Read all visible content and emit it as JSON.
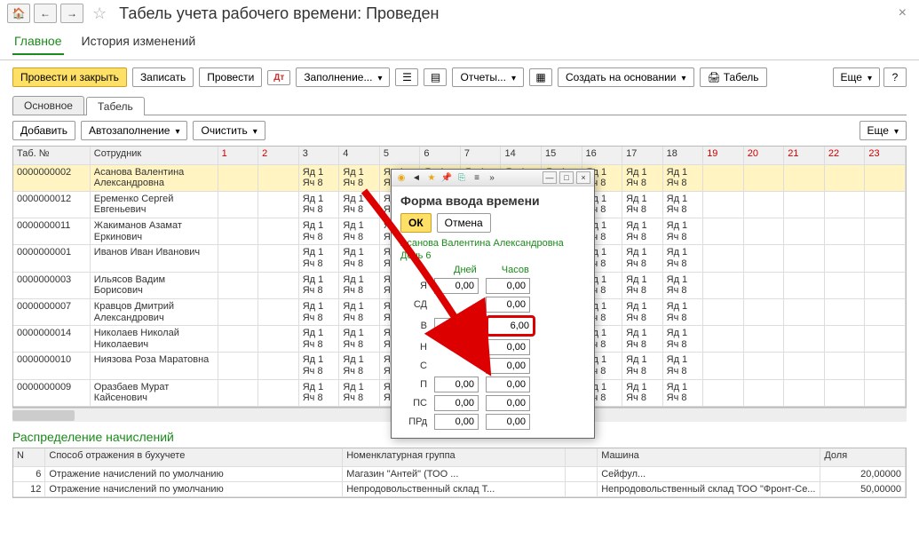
{
  "header": {
    "title": "Табель учета рабочего времени: Проведен"
  },
  "mainTabs": {
    "main": "Главное",
    "history": "История изменений"
  },
  "toolbar": {
    "postClose": "Провести и закрыть",
    "save": "Записать",
    "post": "Провести",
    "fill": "Заполнение...",
    "reports": "Отчеты...",
    "createFrom": "Создать на основании",
    "tabel": "Табель",
    "more": "Еще"
  },
  "subtabs": {
    "main": "Основное",
    "tabel": "Табель"
  },
  "actions": {
    "add": "Добавить",
    "autofill": "Автозаполнение",
    "clear": "Очистить",
    "more": "Еще"
  },
  "tableHead": {
    "num": "Таб. №",
    "emp": "Сотрудник"
  },
  "days": [
    "1",
    "2",
    "3",
    "4",
    "5",
    "6",
    "7",
    "14",
    "15",
    "16",
    "17",
    "18",
    "19",
    "20",
    "21",
    "22",
    "23"
  ],
  "weekendCols": [
    4,
    5,
    16,
    17,
    18,
    19,
    20
  ],
  "cell": {
    "l1": "Яд 1",
    "l2": "Яч 8"
  },
  "rows": [
    {
      "num": "0000000002",
      "emp": "Асанова Валентина Александровна",
      "sel": true
    },
    {
      "num": "0000000012",
      "emp": "Еременко Сергей Евгеньевич"
    },
    {
      "num": "0000000011",
      "emp": "Жакиманов Азамат Еркинович"
    },
    {
      "num": "0000000001",
      "emp": "Иванов Иван Иванович"
    },
    {
      "num": "0000000003",
      "emp": "Ильясов Вадим Борисович"
    },
    {
      "num": "0000000007",
      "emp": "Кравцов Дмитрий Александрович"
    },
    {
      "num": "0000000014",
      "emp": "Николаев Николай Николаевич"
    },
    {
      "num": "0000000010",
      "emp": "Ниязова Роза Маратовна"
    },
    {
      "num": "0000000009",
      "emp": "Оразбаев Мурат Кайсенович"
    }
  ],
  "dist": {
    "title": "Распределение начислений",
    "head": {
      "n": "N",
      "method": "Способ отражения в бухучете",
      "group": "Номенклатурная группа",
      "machine": "Машина",
      "share": "Доля"
    },
    "rows": [
      {
        "n": "6",
        "method": "Отражение начислений по умолчанию",
        "group": "Магазин \"Антей\" (ТОО ...",
        "machine": "Сейфул...",
        "share": "20,00000"
      },
      {
        "n": "12",
        "method": "Отражение начислений по умолчанию",
        "group": "Непродовольственный склад Т...",
        "machine": "Непродовольственный склад ТОО \"Фронт-Се...",
        "share": "50,00000"
      }
    ]
  },
  "modal": {
    "title": "Форма ввода времени",
    "ok": "ОК",
    "cancel": "Отмена",
    "caption1": "Асанова Валентина Александровна",
    "caption2": "День 6",
    "head": {
      "days": "Дней",
      "hours": "Часов"
    },
    "rows": [
      {
        "code": "Я",
        "d": "0,00",
        "h": "0,00"
      },
      {
        "code": "СД",
        "d": "",
        "h": "0,00"
      },
      {
        "code": "В",
        "d": "0,00",
        "h": "6,00",
        "hi": true
      },
      {
        "code": "Н",
        "d": "",
        "h": "0,00"
      },
      {
        "code": "С",
        "d": "",
        "h": "0,00"
      },
      {
        "code": "П",
        "d": "0,00",
        "h": "0,00"
      },
      {
        "code": "ПС",
        "d": "0,00",
        "h": "0,00"
      },
      {
        "code": "ПРд",
        "d": "0,00",
        "h": "0,00"
      }
    ]
  }
}
